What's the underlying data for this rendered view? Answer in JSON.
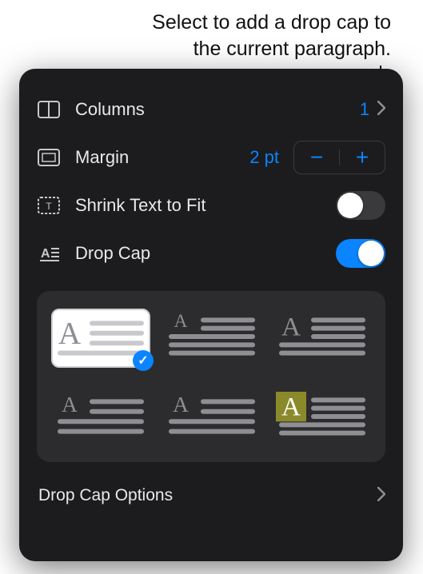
{
  "callout": "Select to add a drop cap to the current paragraph.",
  "panel": {
    "columns": {
      "label": "Columns",
      "value": "1"
    },
    "margin": {
      "label": "Margin",
      "value": "2 pt"
    },
    "shrink": {
      "label": "Shrink Text to Fit",
      "on": false
    },
    "dropcap": {
      "label": "Drop Cap",
      "on": true
    },
    "options_label": "Drop Cap Options",
    "styles": [
      {
        "name": "dropcap-style-1",
        "selected": true,
        "capColor": "#8e8e93",
        "accent": null,
        "lines": 4,
        "capLines": 3,
        "capLeft": true,
        "bg": false
      },
      {
        "name": "dropcap-style-2",
        "selected": false,
        "capColor": "#8e8e93",
        "accent": null,
        "lines": 5,
        "capLines": 2,
        "capLeft": true,
        "bg": false
      },
      {
        "name": "dropcap-style-3",
        "selected": false,
        "capColor": "#8e8e93",
        "accent": null,
        "lines": 5,
        "capLines": 3,
        "capLeft": true,
        "bg": false
      },
      {
        "name": "dropcap-style-4",
        "selected": false,
        "capColor": "#8e8e93",
        "accent": null,
        "lines": 4,
        "capLines": 2,
        "capLeft": true,
        "bg": false
      },
      {
        "name": "dropcap-style-5",
        "selected": false,
        "capColor": "#8e8e93",
        "accent": null,
        "lines": 4,
        "capLines": 2,
        "capLeft": true,
        "bg": false
      },
      {
        "name": "dropcap-style-6",
        "selected": false,
        "capColor": "#ffffff",
        "accent": "#8a8a2a",
        "lines": 5,
        "capLines": 3,
        "capLeft": true,
        "bg": true
      }
    ]
  }
}
